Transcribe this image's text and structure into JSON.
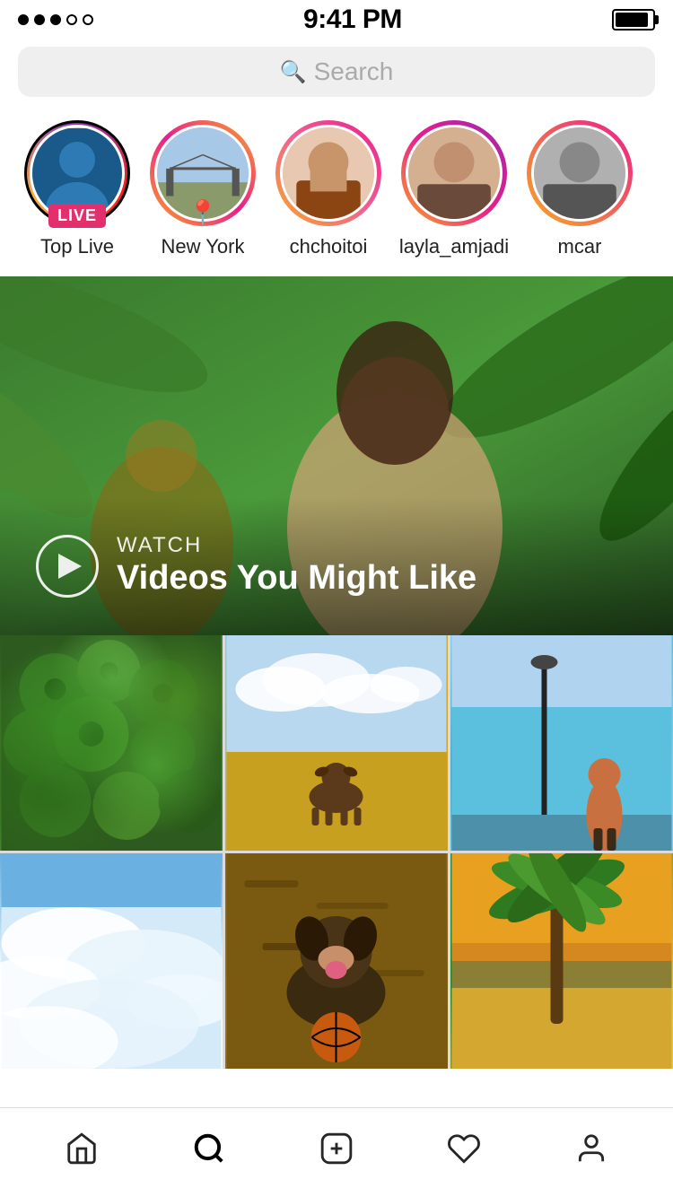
{
  "status_bar": {
    "time": "9:41 PM",
    "dots": [
      true,
      true,
      true,
      false,
      false
    ]
  },
  "search": {
    "placeholder": "Search"
  },
  "stories": [
    {
      "id": "top-live",
      "label": "Top Live",
      "ring_type": "live-ring",
      "badge": "LIVE",
      "badge_type": "live"
    },
    {
      "id": "new-york",
      "label": "New York",
      "ring_type": "location-ring",
      "badge_type": "location"
    },
    {
      "id": "chchoitoi",
      "label": "chchoitoi",
      "ring_type": "pink-ring",
      "badge_type": "none"
    },
    {
      "id": "layla-amjadi",
      "label": "layla_amjadi",
      "ring_type": "gradient-ring",
      "badge_type": "none"
    },
    {
      "id": "mcar",
      "label": "mcar",
      "ring_type": "gray-ring",
      "badge_type": "none"
    }
  ],
  "watch_section": {
    "label": "WATCH",
    "title": "Videos You Might Like"
  },
  "grid": {
    "cells": [
      {
        "id": 1,
        "class": "grid-cell-1"
      },
      {
        "id": 2,
        "class": "grid-cell-2"
      },
      {
        "id": 3,
        "class": "grid-cell-3"
      },
      {
        "id": 4,
        "class": "grid-cell-4"
      },
      {
        "id": 5,
        "class": "grid-cell-5"
      },
      {
        "id": 6,
        "class": "grid-cell-6"
      }
    ]
  },
  "nav": {
    "items": [
      {
        "id": "home",
        "label": "Home",
        "icon": "home"
      },
      {
        "id": "search",
        "label": "Search",
        "icon": "search"
      },
      {
        "id": "add",
        "label": "Add",
        "icon": "plus"
      },
      {
        "id": "heart",
        "label": "Activity",
        "icon": "heart"
      },
      {
        "id": "profile",
        "label": "Profile",
        "icon": "user"
      }
    ]
  }
}
